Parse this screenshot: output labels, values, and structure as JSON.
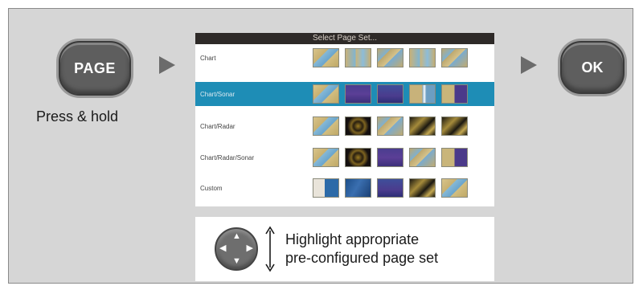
{
  "buttons": {
    "page_label": "PAGE",
    "ok_label": "OK"
  },
  "caption": "Press & hold",
  "screen": {
    "title": "Select Page Set...",
    "rows": [
      {
        "label": "Chart",
        "thumbs": [
          "chart-thumb",
          "chart-thumb",
          "chart-thumb",
          "chart-thumb",
          "chart-thumb"
        ]
      },
      {
        "label": "Chart/Sonar",
        "selected": true,
        "thumbs": [
          "chart-thumb",
          "sonar-thumb",
          "sonar-thumb",
          "chart-thumb",
          "split-thumb"
        ]
      },
      {
        "label": "Chart/Radar",
        "thumbs": [
          "chart-thumb",
          "radar-thumb",
          "chart-thumb",
          "radar-thumb",
          "radar-thumb"
        ]
      },
      {
        "label": "Chart/Radar/Sonar",
        "thumbs": [
          "chart-thumb",
          "radar-thumb",
          "sonar-thumb",
          "chart-thumb",
          "split-thumb"
        ]
      },
      {
        "label": "Custom",
        "thumbs": [
          "logo-thumb",
          "sonar-thumb",
          "sonar-thumb",
          "radar-thumb",
          "chart-thumb"
        ]
      }
    ]
  },
  "hint": {
    "line1": "Highlight appropriate",
    "line2": "pre-configured page set"
  },
  "icons": {
    "dpad": "dpad-icon",
    "updown": "up-down-arrow-icon",
    "arrow": "triangle-right-icon"
  },
  "colors": {
    "panel_bg": "#d6d6d6",
    "selected_row": "#1e8db6",
    "button": "#5e5e5e"
  }
}
